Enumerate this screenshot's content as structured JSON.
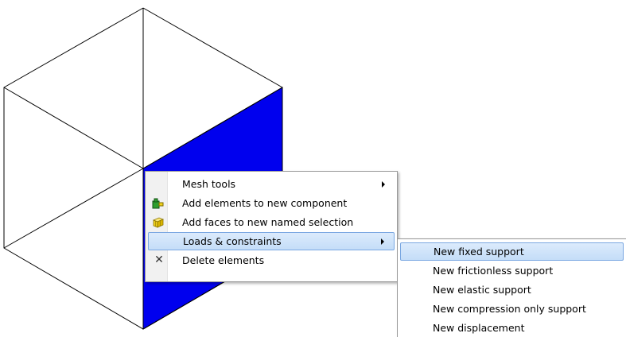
{
  "context_menu": {
    "items": [
      {
        "label": "Mesh tools",
        "submenu": true,
        "icon": null
      },
      {
        "label": "Add elements to new component",
        "submenu": false,
        "icon": "component-puzzle-icon"
      },
      {
        "label": "Add faces to new named selection",
        "submenu": false,
        "icon": "named-selection-cube-icon"
      },
      {
        "label": "Loads & constraints",
        "submenu": true,
        "icon": null,
        "highlighted": true
      },
      {
        "label": "Delete elements",
        "submenu": false,
        "icon": "delete-x-icon"
      }
    ]
  },
  "submenu": {
    "items": [
      {
        "label": "New fixed support",
        "highlighted": true
      },
      {
        "label": "New frictionless support"
      },
      {
        "label": "New elastic support"
      },
      {
        "label": "New compression only support"
      },
      {
        "label": "New displacement"
      }
    ]
  },
  "colors": {
    "selected_face": "#0000ee",
    "menu_highlight_border": "#7aa7e1",
    "menu_highlight_fill": "#cfe4fb",
    "icon_green": "#2e9e2e",
    "icon_yellow": "#f2d21b"
  }
}
